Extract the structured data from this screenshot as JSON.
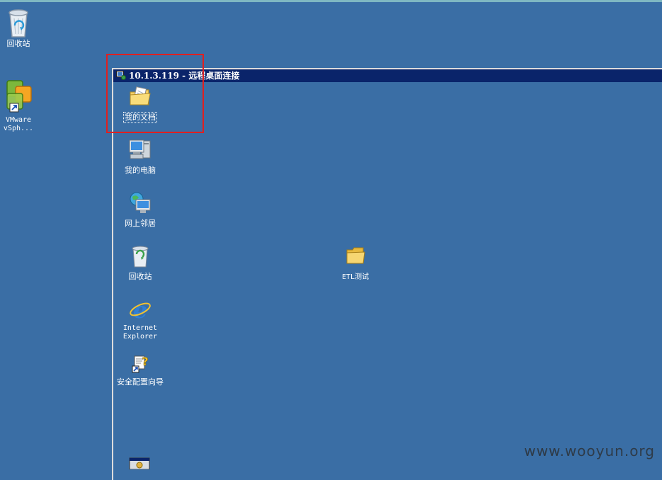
{
  "host_desktop": {
    "icons": [
      {
        "id": "recycle-bin",
        "label": "回收站"
      },
      {
        "id": "vmware",
        "label": "VMware\nvSph..."
      }
    ]
  },
  "rdp_window": {
    "title": "10.1.3.119 - 远程桌面连接",
    "icons": [
      {
        "id": "my-documents",
        "label": "我的文档"
      },
      {
        "id": "my-computer",
        "label": "我的电脑"
      },
      {
        "id": "network-places",
        "label": "网上邻居"
      },
      {
        "id": "recycle-bin",
        "label": "回收站"
      },
      {
        "id": "internet-explorer",
        "label": "Internet\nExplorer"
      },
      {
        "id": "security-wizard",
        "label": "安全配置向导"
      },
      {
        "id": "etl-folder",
        "label": "ETL测试"
      }
    ]
  },
  "annotation": {
    "color": "#e02020"
  },
  "watermark": "www.wooyun.org",
  "colors": {
    "desktop": "#3a6ea5",
    "titlebar": "#0a246a"
  }
}
